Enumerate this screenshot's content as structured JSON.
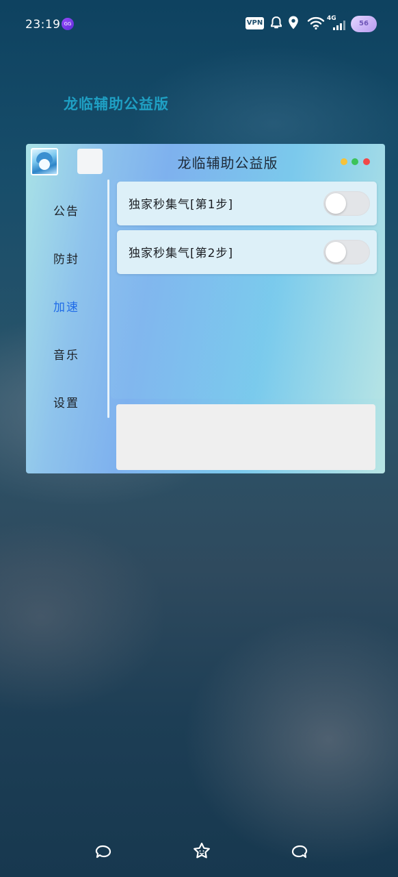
{
  "status_bar": {
    "time": "23:19",
    "app_icon_label": "GG",
    "vpn_label": "VPN",
    "network": "4G",
    "battery": "56",
    "icons": [
      "bell-icon",
      "location-icon",
      "wifi-icon",
      "signal-icon"
    ]
  },
  "page_title": "龙临辅助公益版",
  "window": {
    "title": "龙临辅助公益版",
    "dots": [
      "#f5c23a",
      "#3cc35a",
      "#f04848"
    ],
    "sidebar": {
      "items": [
        {
          "label": "公告",
          "active": false
        },
        {
          "label": "防封",
          "active": false
        },
        {
          "label": "加速",
          "active": true
        },
        {
          "label": "音乐",
          "active": false
        },
        {
          "label": "设置",
          "active": false
        }
      ]
    },
    "rows": [
      {
        "label": "独家秒集气[第1步]",
        "enabled": false
      },
      {
        "label": "独家秒集气[第2步]",
        "enabled": false
      }
    ],
    "accent_color": "#1f6be8"
  },
  "nav_bar": {
    "icons": [
      "back-icon",
      "home-icon",
      "recents-icon"
    ]
  }
}
